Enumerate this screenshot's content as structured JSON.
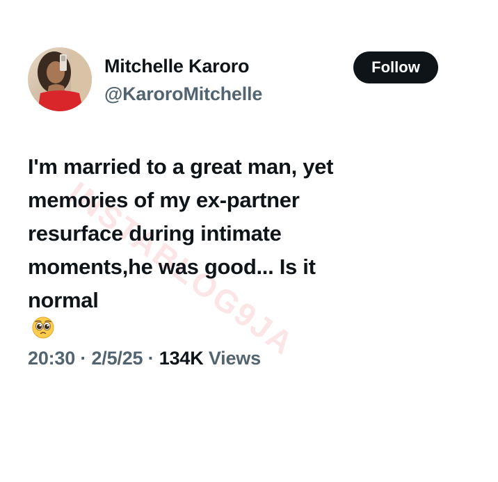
{
  "tweet": {
    "author": {
      "display_name": "Mitchelle Karoro",
      "handle": "@KaroroMitchelle"
    },
    "follow_label": "Follow",
    "text_lines": [
      "I'm married to a great man, yet",
      "memories of my ex-partner",
      "resurface during intimate",
      "moments,he was good... Is it",
      "normal"
    ],
    "emoji": "pleading-face",
    "time": "20:30",
    "separator": "·",
    "date": "2/5/25",
    "views_count": "134K",
    "views_label": "Views"
  },
  "watermark": "INSTABLOG9JA",
  "colors": {
    "text": "#0f1419",
    "secondary": "#536471",
    "button_bg": "#0f1419",
    "button_text": "#ffffff",
    "avatar_dress": "#d9262b"
  }
}
